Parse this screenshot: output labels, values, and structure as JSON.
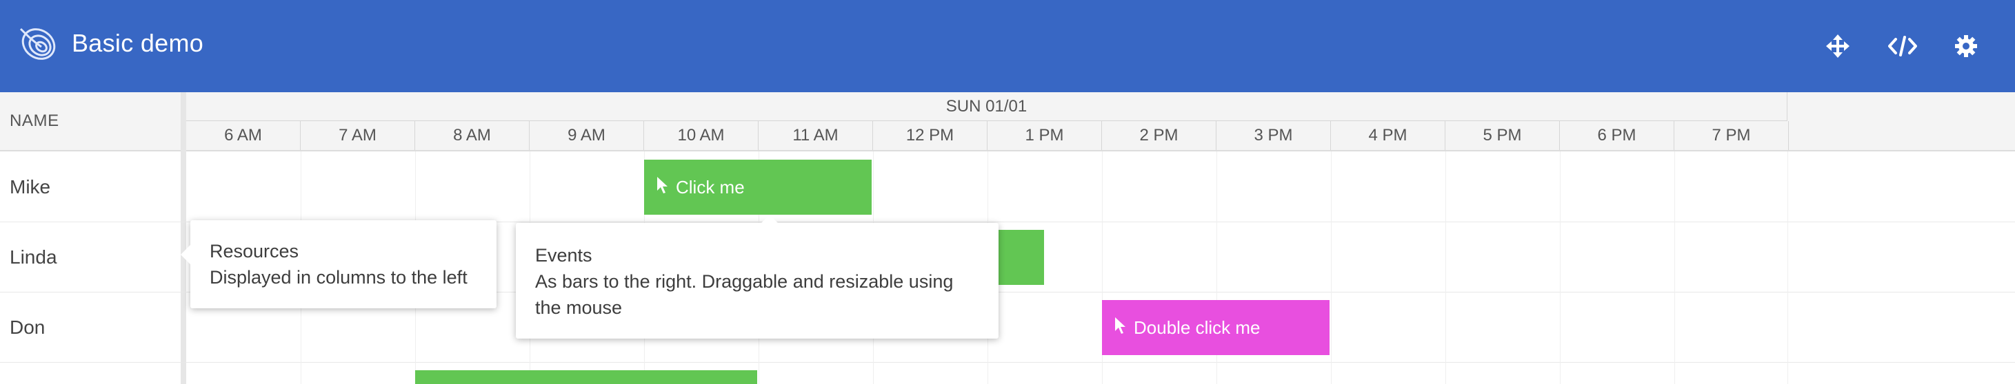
{
  "header": {
    "title": "Basic demo",
    "icons": [
      "logo-icon",
      "move-icon",
      "code-icon",
      "settings-icon"
    ],
    "background": "#3867c4"
  },
  "grid": {
    "name_column_header": "NAME",
    "date_label": "SUN 01/01",
    "hours": [
      "6 AM",
      "7 AM",
      "8 AM",
      "9 AM",
      "10 AM",
      "11 AM",
      "12 PM",
      "1 PM",
      "2 PM",
      "3 PM",
      "4 PM",
      "5 PM",
      "6 PM",
      "7 PM"
    ],
    "resources": [
      "Mike",
      "Linda",
      "Don"
    ]
  },
  "events": {
    "click_me": {
      "label": "Click me",
      "resource": "Mike",
      "start": "10 AM",
      "end": "12 PM",
      "color": "#62c653"
    },
    "linda_event": {
      "resource": "Linda",
      "end": "1:30 PM",
      "color": "#62c653"
    },
    "double_click_me": {
      "label": "Double click me",
      "resource": "Don",
      "start": "2 PM",
      "end": "4 PM",
      "color": "#e84fdf"
    },
    "fourth_row_event": {
      "start": "8 AM",
      "end": "11 AM",
      "color": "#62c653"
    }
  },
  "tooltips": {
    "resources": {
      "title": "Resources",
      "body": "Displayed in columns to the left"
    },
    "events": {
      "title": "Events",
      "body": "As bars to the right. Draggable and resizable using the mouse"
    }
  }
}
